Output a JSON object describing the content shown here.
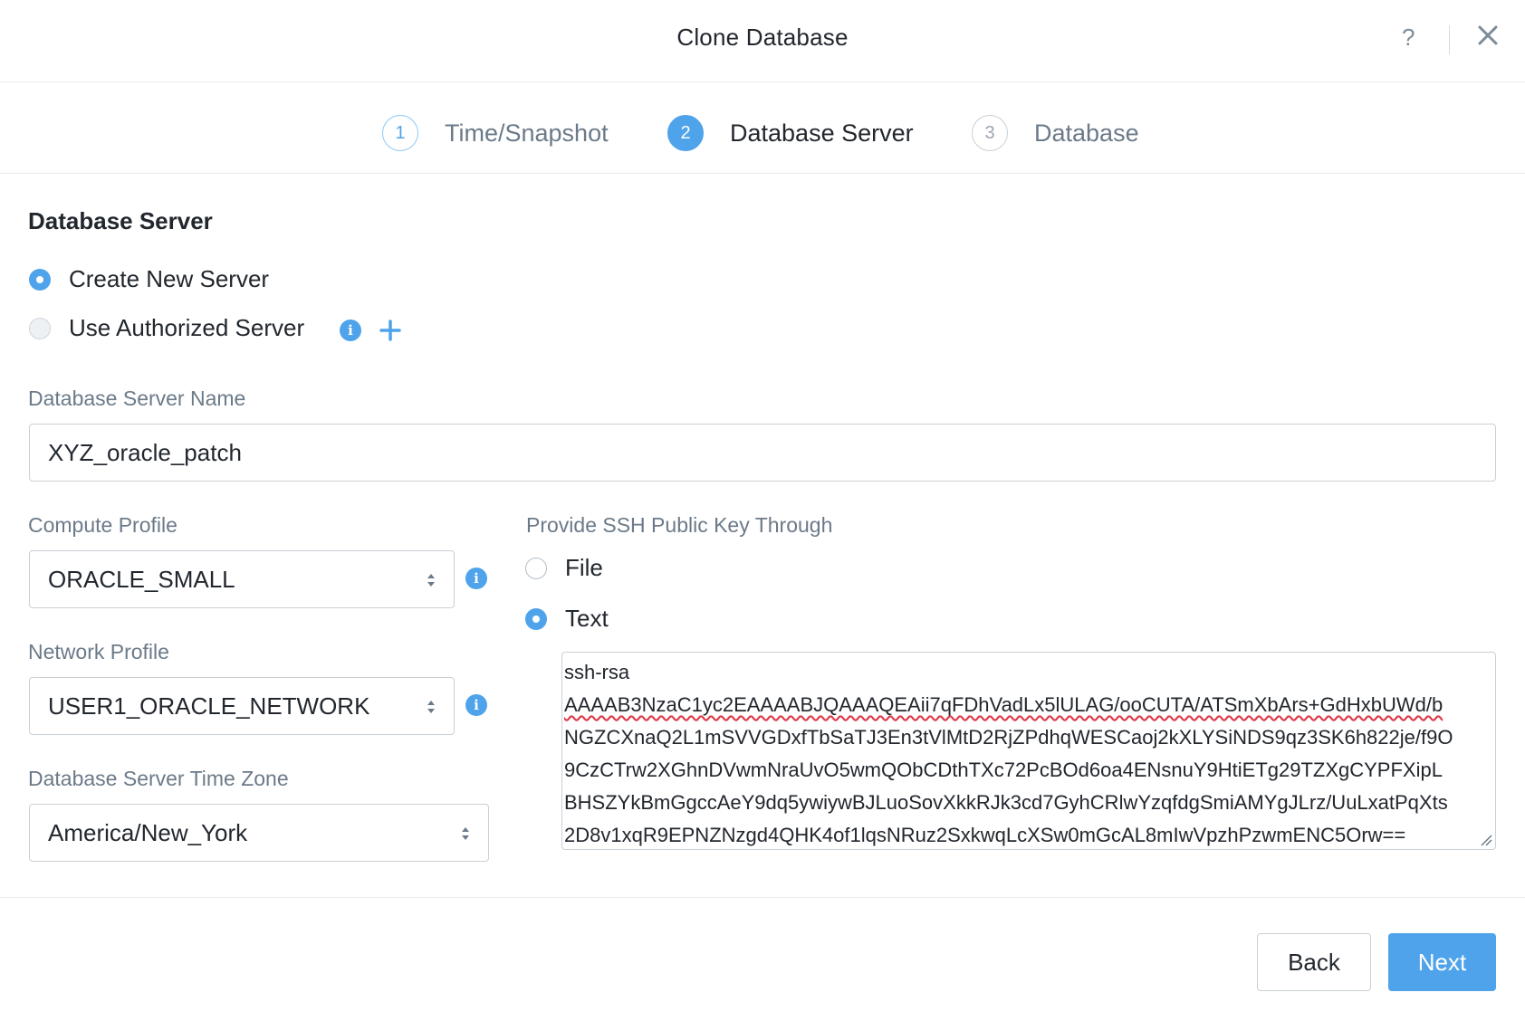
{
  "dialog": {
    "title": "Clone Database",
    "help_label": "?"
  },
  "steps": [
    {
      "number": "1",
      "label": "Time/Snapshot",
      "state": "done"
    },
    {
      "number": "2",
      "label": "Database Server",
      "state": "active"
    },
    {
      "number": "3",
      "label": "Database",
      "state": "pending"
    }
  ],
  "section": {
    "title": "Database Server"
  },
  "server_source": {
    "options": [
      {
        "label": "Create New Server",
        "selected": true
      },
      {
        "label": "Use Authorized Server",
        "selected": false
      }
    ],
    "info_glyph": "i"
  },
  "server_name": {
    "label": "Database Server Name",
    "value": "XYZ_oracle_patch"
  },
  "compute_profile": {
    "label": "Compute Profile",
    "value": "ORACLE_SMALL",
    "info_glyph": "i"
  },
  "network_profile": {
    "label": "Network Profile",
    "value": "USER1_ORACLE_NETWORK",
    "info_glyph": "i"
  },
  "time_zone": {
    "label": "Database Server Time Zone",
    "value": "America/New_York"
  },
  "ssh_key": {
    "label": "Provide SSH Public Key Through",
    "options": [
      {
        "label": "File",
        "selected": false
      },
      {
        "label": "Text",
        "selected": true
      }
    ],
    "lines": [
      "ssh-rsa",
      "AAAAB3NzaC1yc2EAAAABJQAAAQEAii7qFDhVadLx5lULAG/ooCUTA/ATSmXbArs+GdHxbUWd/b",
      "NGZCXnaQ2L1mSVVGDxfTbSaTJ3En3tVlMtD2RjZPdhqWESCaoj2kXLYSiNDS9qz3SK6h822je/f9O",
      "9CzCTrw2XGhnDVwmNraUvO5wmQObCDthTXc72PcBOd6oa4ENsnuY9HtiETg29TZXgCYPFXipL",
      "BHSZYkBmGgccAeY9dq5ywiywBJLuoSovXkkRJk3cd7GyhCRlwYzqfdgSmiAMYgJLrz/UuLxatPqXts",
      "2D8v1xqR9EPNZNzgd4QHK4of1lqsNRuz2SxkwqLcXSw0mGcAL8mIwVpzhPzwmENC5Orw=="
    ]
  },
  "footer": {
    "back_label": "Back",
    "next_label": "Next"
  },
  "colors": {
    "accent": "#4ea3ea",
    "text": "#22272e",
    "muted": "#6b7a89",
    "border": "#c9d0d6"
  }
}
